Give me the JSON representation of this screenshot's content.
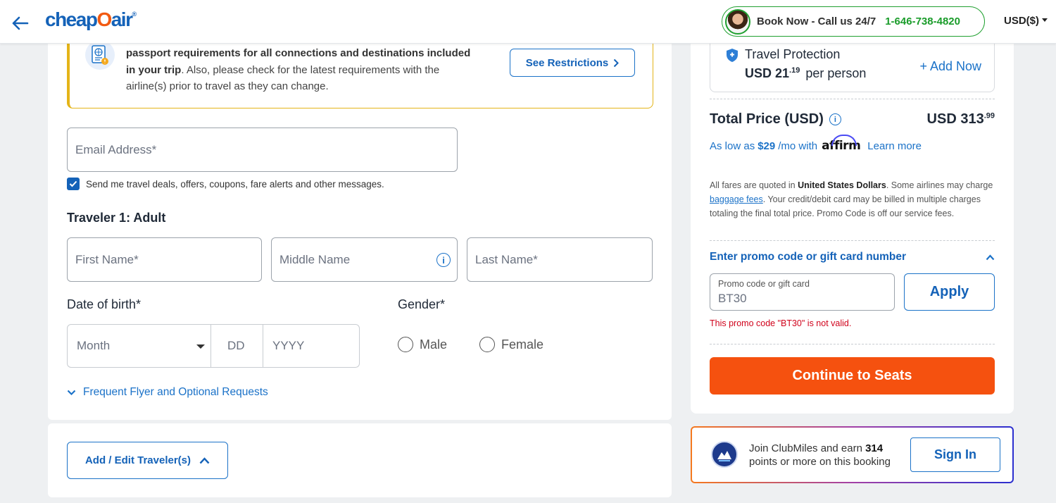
{
  "header": {
    "logo": "cheapOair",
    "logo_reg": "®",
    "call_text": "Book Now - Call us 24/7",
    "phone": "1-646-738-4820",
    "currency": "USD($)"
  },
  "notice": {
    "bold_text": "passport requirements for all connections and destinations included in your trip",
    "rest_text": ". Also, please check for the latest requirements with the airline(s) prior to travel as they can change.",
    "button_label": "See Restrictions"
  },
  "form": {
    "email_placeholder": "Email Address*",
    "deals_checkbox_label": "Send me travel deals, offers, coupons, fare alerts and other messages.",
    "deals_checked": true,
    "traveler_heading": "Traveler 1: Adult",
    "first_name_placeholder": "First Name*",
    "middle_name_placeholder": "Middle Name",
    "last_name_placeholder": "Last Name*",
    "dob_label": "Date of birth*",
    "month_placeholder": "Month",
    "day_placeholder": "DD",
    "year_placeholder": "YYYY",
    "gender_label": "Gender*",
    "gender_male": "Male",
    "gender_female": "Female",
    "frequent_flyer_link": "Frequent Flyer and Optional Requests",
    "add_edit_travelers": "Add / Edit Traveler(s)"
  },
  "summary": {
    "travel_protection_title": "Travel Protection",
    "travel_protection_price_main": "USD 21",
    "travel_protection_price_cents": ".19",
    "travel_protection_per": "per person",
    "add_now": "+ Add Now",
    "total_label": "Total Price (USD)",
    "total_main": "USD 313",
    "total_cents": ".99",
    "affirm_prefix": "As low as",
    "affirm_amount": "$29",
    "affirm_suffix": "/mo with",
    "affirm_brand": "affirm",
    "affirm_learn": "Learn more",
    "fares_1": "All fares are quoted in ",
    "fares_bold": "United States Dollars",
    "fares_2": ". Some airlines may charge ",
    "fares_link": "baggage fees",
    "fares_3": ". Your credit/debit card may be billed in multiple charges totaling the final total price. Promo Code is off our service fees.",
    "promo_heading": "Enter promo code or gift card number",
    "promo_label": "Promo code or gift card",
    "promo_value": "BT30",
    "apply_label": "Apply",
    "promo_error": "This promo code \"BT30\" is not valid.",
    "continue_label": "Continue to Seats"
  },
  "club": {
    "text_prefix": "Join ClubMiles and earn ",
    "points": "314",
    "text_suffix": "points or more on this booking",
    "sign_in": "Sign In"
  },
  "colors": {
    "brand_blue": "#1462b8",
    "accent_orange": "#f5510f",
    "phone_green": "#1a9c2a",
    "error_red": "#d0021b",
    "notice_border": "#e4b418"
  }
}
